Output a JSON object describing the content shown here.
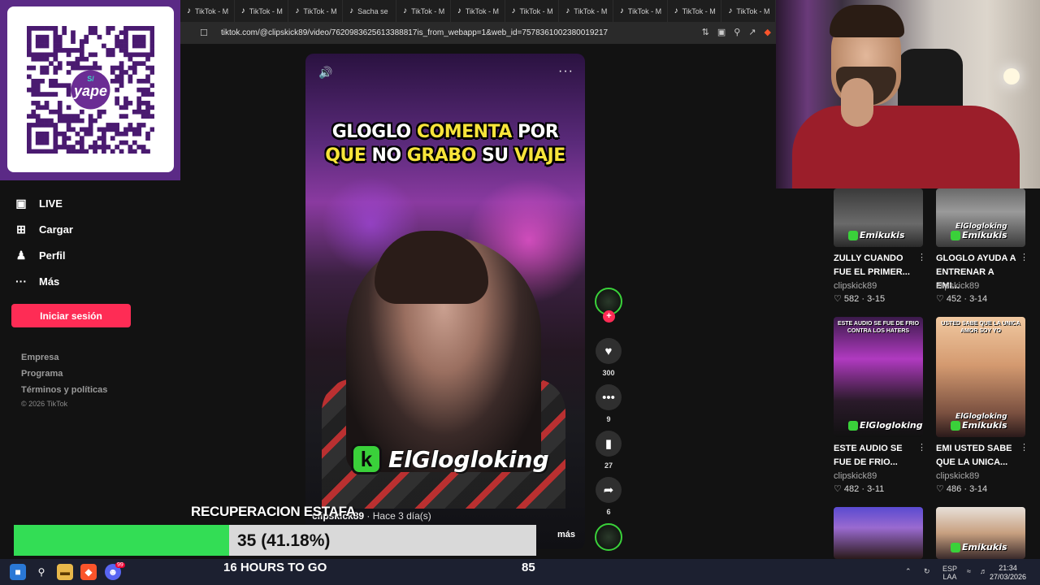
{
  "browser": {
    "tabs": [
      {
        "label": "TikTok - M"
      },
      {
        "label": "TikTok - M"
      },
      {
        "label": "TikTok - M"
      },
      {
        "label": "Sacha se"
      },
      {
        "label": "TikTok - M"
      },
      {
        "label": "TikTok - M"
      },
      {
        "label": "TikTok - M"
      },
      {
        "label": "TikTok - M"
      },
      {
        "label": "TikTok - M"
      },
      {
        "label": "TikTok - M"
      },
      {
        "label": "TikTok - M"
      }
    ],
    "url": "tiktok.com/@clipskick89/video/7620983625613388817is_from_webapp=1&web_id=7578361002380019217"
  },
  "qr": {
    "brand": "yape",
    "badge": "S/"
  },
  "sidebar": {
    "items": [
      {
        "icon": "live-icon",
        "label": "LIVE"
      },
      {
        "icon": "upload-icon",
        "label": "Cargar"
      },
      {
        "icon": "profile-icon",
        "label": "Perfil"
      },
      {
        "icon": "more-icon",
        "label": "Más"
      }
    ],
    "login_label": "Iniciar sesión",
    "footer": [
      "Empresa",
      "Programa",
      "Términos y políticas"
    ],
    "copyright": "© 2026 TikTok"
  },
  "video": {
    "caption_line1": [
      {
        "t": "GLOGLO ",
        "c": "w"
      },
      {
        "t": "COMENTA ",
        "c": "y"
      },
      {
        "t": "POR",
        "c": "w"
      }
    ],
    "caption_line2": [
      {
        "t": "QUE ",
        "c": "y"
      },
      {
        "t": "NO ",
        "c": "w"
      },
      {
        "t": "GRABO ",
        "c": "y"
      },
      {
        "t": "SU ",
        "c": "w"
      },
      {
        "t": "VIAJE",
        "c": "y"
      }
    ],
    "brand_name": "ElGlogloking",
    "author": "clipskick89",
    "posted": "· Hace 3 día(s)",
    "more_label": "más"
  },
  "actions": {
    "likes": "300",
    "comments": "9",
    "saves": "27",
    "shares": "6"
  },
  "related": [
    {
      "title": "ZULLY CUANDO FUE EL PRIMER...",
      "author": "clipskick89",
      "likes": "582",
      "date": "3-15",
      "tag": "Emikukis",
      "tag2": "",
      "topcap": ""
    },
    {
      "title": "GLOGLO AYUDA A ENTRENAR A EMI...",
      "author": "clipskick89",
      "likes": "452",
      "date": "3-14",
      "tag": "Emikukis",
      "tag2": "ElGlogloking",
      "topcap": ""
    },
    {
      "title": "ESTE AUDIO SE FUE DE FRIO...",
      "author": "clipskick89",
      "likes": "482",
      "date": "3-11",
      "tag": "ElGlogloking",
      "tag2": "",
      "topcap": "ESTE AUDIO SE FUE DE FRIO CONTRA LOS HATERS"
    },
    {
      "title": "EMI USTED SABE QUE LA UNICA...",
      "author": "clipskick89",
      "likes": "486",
      "date": "3-14",
      "tag": "Emikukis",
      "tag2": "ElGlogloking",
      "topcap": "USTED SABE QUE LA UNICA AMOR SOY YO"
    },
    {
      "title": "",
      "author": "",
      "likes": "",
      "date": "",
      "tag": "",
      "tag2": "",
      "topcap": ""
    },
    {
      "title": "",
      "author": "",
      "likes": "",
      "date": "",
      "tag": "Emikukis",
      "tag2": "",
      "topcap": ""
    }
  ],
  "donation": {
    "title": "RECUPERACION ESTAFA",
    "progress_text": "35 (41.18%)",
    "progress_fraction": 0.4118,
    "time_left": "16 HOURS TO GO",
    "target": "85"
  },
  "taskbar": {
    "lang": "ESP",
    "layout": "LAA",
    "time": "21:34",
    "date": "27/03/2026",
    "discord_badge": "99"
  },
  "colors": {
    "tiktok_red": "#fe2c55",
    "progress_green": "#33dd55",
    "yape_purple": "#5b2a86",
    "caption_yellow": "#f7e43a"
  }
}
